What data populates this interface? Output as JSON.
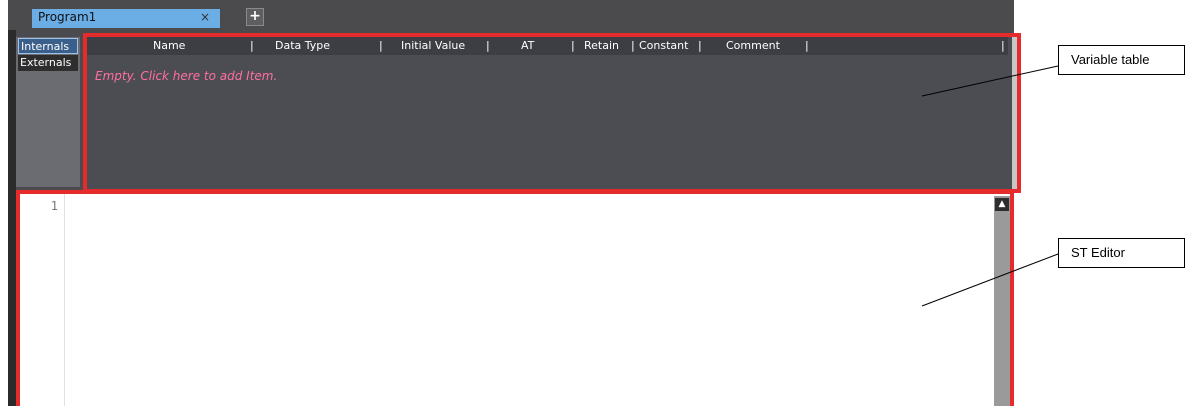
{
  "tabs": {
    "active_tab": "Program1",
    "close_glyph": "×",
    "add_glyph": "+"
  },
  "side_tabs": [
    "Internals",
    "Externals"
  ],
  "variable_table": {
    "columns": [
      "Name",
      "Data Type",
      "Initial Value",
      "AT",
      "Retain",
      "Constant",
      "Comment"
    ],
    "empty_message": "Empty. Click here to add Item."
  },
  "editor": {
    "line_numbers": [
      "1"
    ],
    "scroll_up_icon": "▲"
  },
  "callouts": {
    "variable_table": "Variable table",
    "st_editor": "ST Editor"
  },
  "colors": {
    "highlight_border": "#e52b2b",
    "active_tab": "#6baee6",
    "empty_message": "#ff6fa0"
  }
}
